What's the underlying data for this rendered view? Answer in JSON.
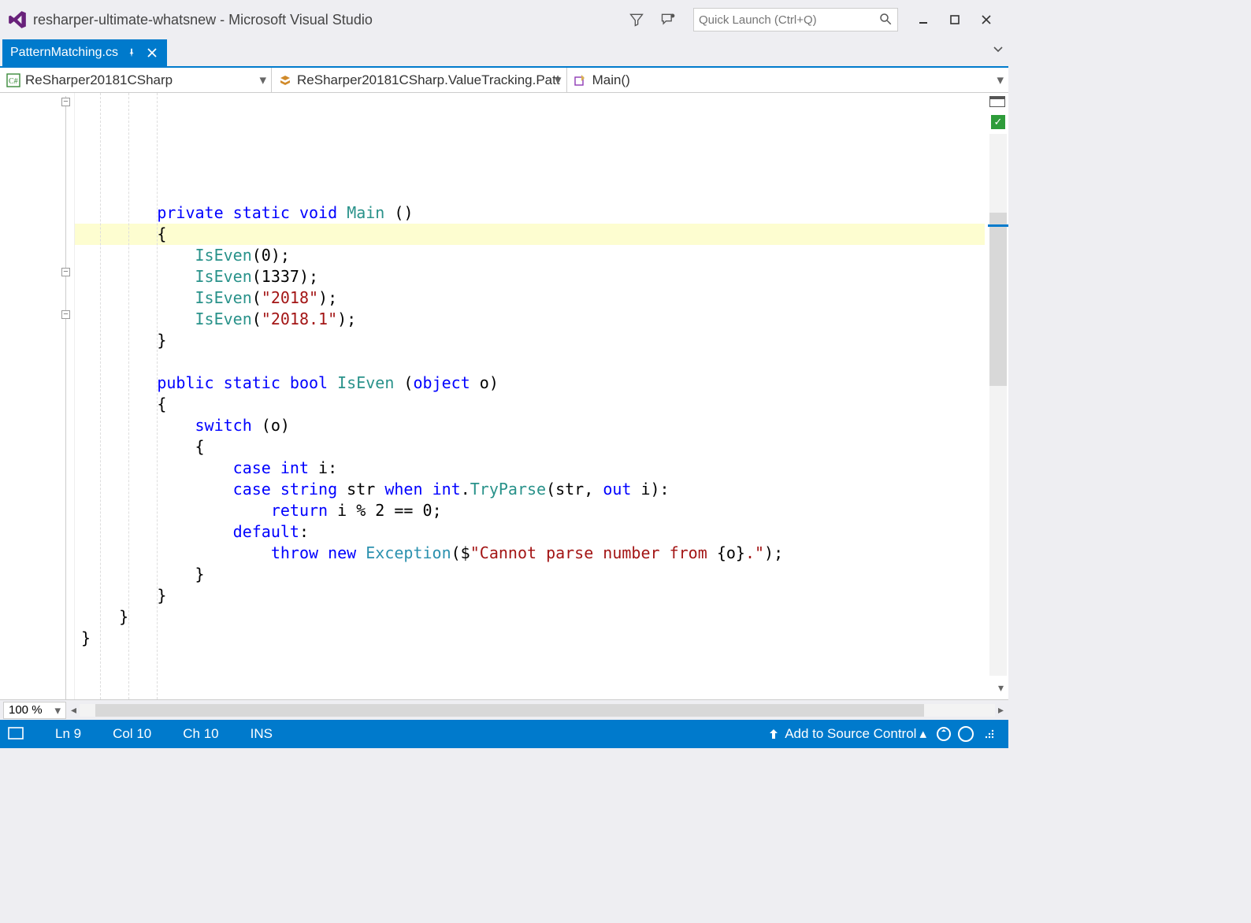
{
  "title_bar": {
    "title": "resharper-ultimate-whatsnew - Microsoft Visual Studio"
  },
  "quick_launch": {
    "placeholder": "Quick Launch (Ctrl+Q)"
  },
  "tab": {
    "file_name": "PatternMatching.cs"
  },
  "nav": {
    "project": "ReSharper20181CSharp",
    "type": "ReSharper20181CSharp.ValueTracking.Patt",
    "member": "Main()"
  },
  "code": {
    "lines": [
      [
        {
          "t": "kw",
          "v": "private"
        },
        {
          "t": "p",
          "v": " "
        },
        {
          "t": "kw",
          "v": "static"
        },
        {
          "t": "p",
          "v": " "
        },
        {
          "t": "kw",
          "v": "void"
        },
        {
          "t": "p",
          "v": " "
        },
        {
          "t": "mth",
          "v": "Main"
        },
        {
          "t": "p",
          "v": " ()"
        }
      ],
      [
        {
          "t": "p",
          "v": "{"
        }
      ],
      [
        {
          "t": "p",
          "v": "    "
        },
        {
          "t": "mth",
          "v": "IsEven"
        },
        {
          "t": "p",
          "v": "("
        },
        {
          "t": "num",
          "v": "0"
        },
        {
          "t": "p",
          "v": ");"
        }
      ],
      [
        {
          "t": "p",
          "v": "    "
        },
        {
          "t": "mth",
          "v": "IsEven"
        },
        {
          "t": "p",
          "v": "("
        },
        {
          "t": "num",
          "v": "1337"
        },
        {
          "t": "p",
          "v": ");"
        }
      ],
      [
        {
          "t": "p",
          "v": "    "
        },
        {
          "t": "mth",
          "v": "IsEven"
        },
        {
          "t": "p",
          "v": "("
        },
        {
          "t": "str",
          "v": "\"2018\""
        },
        {
          "t": "p",
          "v": ");"
        }
      ],
      [
        {
          "t": "p",
          "v": "    "
        },
        {
          "t": "mth",
          "v": "IsEven"
        },
        {
          "t": "p",
          "v": "("
        },
        {
          "t": "str",
          "v": "\"2018.1\""
        },
        {
          "t": "p",
          "v": ");"
        }
      ],
      [
        {
          "t": "p",
          "v": "}"
        }
      ],
      [
        {
          "t": "p",
          "v": ""
        }
      ],
      [
        {
          "t": "kw",
          "v": "public"
        },
        {
          "t": "p",
          "v": " "
        },
        {
          "t": "kw",
          "v": "static"
        },
        {
          "t": "p",
          "v": " "
        },
        {
          "t": "kw",
          "v": "bool"
        },
        {
          "t": "p",
          "v": " "
        },
        {
          "t": "mth",
          "v": "IsEven"
        },
        {
          "t": "p",
          "v": " ("
        },
        {
          "t": "kw",
          "v": "object"
        },
        {
          "t": "p",
          "v": " o)"
        }
      ],
      [
        {
          "t": "p",
          "v": "{"
        }
      ],
      [
        {
          "t": "p",
          "v": "    "
        },
        {
          "t": "kw",
          "v": "switch"
        },
        {
          "t": "p",
          "v": " (o)"
        }
      ],
      [
        {
          "t": "p",
          "v": "    {"
        }
      ],
      [
        {
          "t": "p",
          "v": "        "
        },
        {
          "t": "kw",
          "v": "case"
        },
        {
          "t": "p",
          "v": " "
        },
        {
          "t": "kw",
          "v": "int"
        },
        {
          "t": "p",
          "v": " i:"
        }
      ],
      [
        {
          "t": "p",
          "v": "        "
        },
        {
          "t": "kw",
          "v": "case"
        },
        {
          "t": "p",
          "v": " "
        },
        {
          "t": "kw",
          "v": "string"
        },
        {
          "t": "p",
          "v": " str "
        },
        {
          "t": "kw",
          "v": "when"
        },
        {
          "t": "p",
          "v": " "
        },
        {
          "t": "kw",
          "v": "int"
        },
        {
          "t": "p",
          "v": "."
        },
        {
          "t": "mth",
          "v": "TryParse"
        },
        {
          "t": "p",
          "v": "(str, "
        },
        {
          "t": "kw",
          "v": "out"
        },
        {
          "t": "p",
          "v": " i):"
        }
      ],
      [
        {
          "t": "p",
          "v": "            "
        },
        {
          "t": "kw",
          "v": "return"
        },
        {
          "t": "p",
          "v": " i % "
        },
        {
          "t": "num",
          "v": "2"
        },
        {
          "t": "p",
          "v": " == "
        },
        {
          "t": "num",
          "v": "0"
        },
        {
          "t": "p",
          "v": ";"
        }
      ],
      [
        {
          "t": "p",
          "v": "        "
        },
        {
          "t": "kw",
          "v": "default"
        },
        {
          "t": "p",
          "v": ":"
        }
      ],
      [
        {
          "t": "p",
          "v": "            "
        },
        {
          "t": "kw",
          "v": "throw"
        },
        {
          "t": "p",
          "v": " "
        },
        {
          "t": "kw",
          "v": "new"
        },
        {
          "t": "p",
          "v": " "
        },
        {
          "t": "typ",
          "v": "Exception"
        },
        {
          "t": "p",
          "v": "($"
        },
        {
          "t": "str",
          "v": "\"Cannot parse number from "
        },
        {
          "t": "p",
          "v": "{o}"
        },
        {
          "t": "str",
          "v": ".\""
        },
        {
          "t": "p",
          "v": ");"
        }
      ],
      [
        {
          "t": "p",
          "v": "    }"
        }
      ],
      [
        {
          "t": "p",
          "v": "}"
        }
      ]
    ],
    "base_indent": "        ",
    "tail_lines": [
      "    }",
      "}"
    ],
    "highlight_index": 1
  },
  "zoom": {
    "level": "100 %"
  },
  "status": {
    "line": "Ln 9",
    "col": "Col 10",
    "ch": "Ch 10",
    "ins": "INS",
    "source_control": "Add to Source Control"
  }
}
